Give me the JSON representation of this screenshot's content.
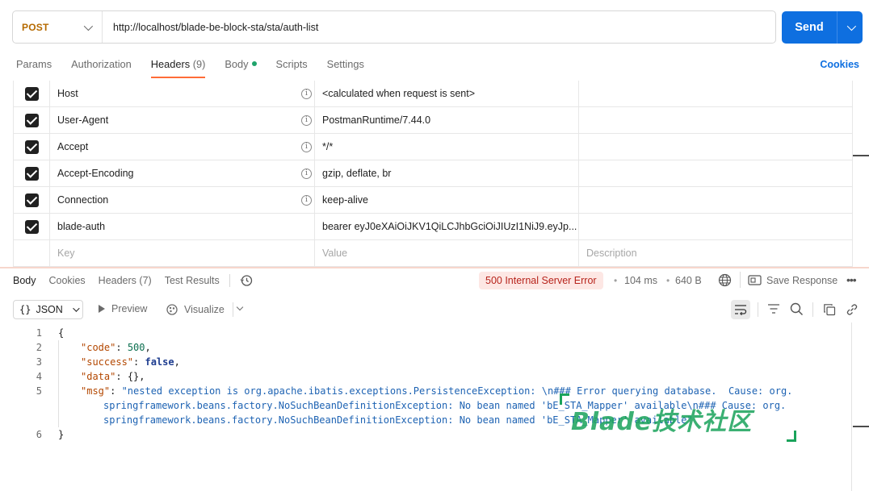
{
  "request": {
    "method": "POST",
    "url": "http://localhost/blade-be-block-sta/sta/auth-list",
    "send_label": "Send"
  },
  "request_tabs": [
    {
      "label": "Params"
    },
    {
      "label": "Authorization"
    },
    {
      "label": "Headers",
      "count": "(9)"
    },
    {
      "label": "Body"
    },
    {
      "label": "Scripts"
    },
    {
      "label": "Settings"
    }
  ],
  "cookies_link": "Cookies",
  "headers": [
    {
      "key": "Host",
      "value": "<calculated when request is sent>",
      "checked": true,
      "info": true
    },
    {
      "key": "User-Agent",
      "value": "PostmanRuntime/7.44.0",
      "checked": true,
      "info": true
    },
    {
      "key": "Accept",
      "value": "*/*",
      "checked": true,
      "info": true
    },
    {
      "key": "Accept-Encoding",
      "value": "gzip, deflate, br",
      "checked": true,
      "info": true
    },
    {
      "key": "Connection",
      "value": "keep-alive",
      "checked": true,
      "info": true
    },
    {
      "key": "blade-auth",
      "value": "bearer eyJ0eXAiOiJKV1QiLCJhbGciOiJIUzI1NiJ9.eyJp...",
      "checked": true,
      "info": false
    }
  ],
  "new_row": {
    "key_placeholder": "Key",
    "value_placeholder": "Value",
    "description_placeholder": "Description"
  },
  "response_tabs": [
    {
      "label": "Body"
    },
    {
      "label": "Cookies"
    },
    {
      "label": "Headers",
      "count": "(7)"
    },
    {
      "label": "Test Results"
    }
  ],
  "response_status": {
    "status": "500 Internal Server Error",
    "time": "104 ms",
    "size": "640 B",
    "save_label": "Save Response"
  },
  "response_toolbar": {
    "format_braces": "{}",
    "format": "JSON",
    "preview": "Preview",
    "visualize": "Visualize"
  },
  "response_body": {
    "lines": [
      {
        "n": "1",
        "text": "{"
      },
      {
        "n": "2",
        "key": "\"code\"",
        "colon": ": ",
        "value": "500",
        "tail": ","
      },
      {
        "n": "3",
        "key": "\"success\"",
        "colon": ": ",
        "value": "false",
        "tail": ","
      },
      {
        "n": "4",
        "key": "\"data\"",
        "colon": ": ",
        "value": "{}",
        "tail": ","
      },
      {
        "n": "5",
        "key": "\"msg\"",
        "colon": ": ",
        "value": "\"nested exception is org.apache.ibatis.exceptions.PersistenceException: \\n### Error querying database.  Cause: org."
      },
      {
        "n": "",
        "value": "springframework.beans.factory.NoSuchBeanDefinitionException: No bean named 'bE_STA_Mapper' available\\n### Cause: org."
      },
      {
        "n": "",
        "value": "springframework.beans.factory.NoSuchBeanDefinitionException: No bean named 'bE_STA_Mapper' available\""
      },
      {
        "n": "6",
        "text": "}"
      }
    ]
  },
  "watermark": "Blade技术社区"
}
